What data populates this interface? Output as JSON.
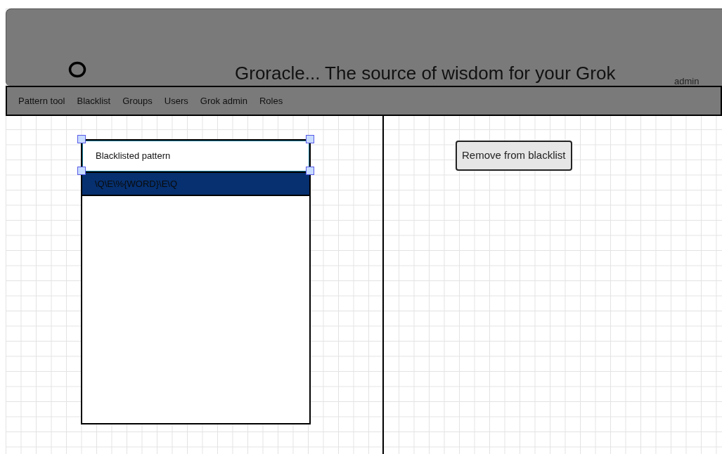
{
  "header": {
    "title": "Groracle... The source of wisdom for your Grok",
    "user": "admin"
  },
  "nav": [
    {
      "label": "Pattern tool"
    },
    {
      "label": "Blacklist"
    },
    {
      "label": "Groups"
    },
    {
      "label": "Users"
    },
    {
      "label": "Grok admin"
    },
    {
      "label": "Roles"
    }
  ],
  "list": {
    "header": "Blacklisted pattern",
    "rows": [
      {
        "text": "\\Q\\E\\%{WORD}\\E\\Q",
        "selected": true
      }
    ]
  },
  "buttons": [
    "Remove from blacklist"
  ]
}
